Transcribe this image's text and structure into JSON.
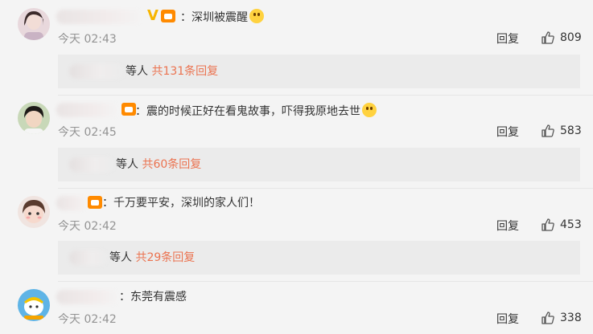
{
  "comments": [
    {
      "text": "：深圳被震醒",
      "has_v_badge": true,
      "time": "今天 02:43",
      "reply_label": "回复",
      "likes": "809",
      "sub": {
        "suffix": "等人",
        "count": "共131条回复"
      }
    },
    {
      "text": "：震的时候正好在看鬼故事，吓得我原地去世",
      "has_v_badge": false,
      "time": "今天 02:45",
      "reply_label": "回复",
      "likes": "583",
      "sub": {
        "suffix": "等人",
        "count": "共60条回复"
      }
    },
    {
      "text": "：千万要平安，深圳的家人们！",
      "has_v_badge": false,
      "time": "今天 02:42",
      "reply_label": "回复",
      "likes": "453",
      "sub": {
        "suffix": "等人",
        "count": "共29条回复"
      }
    },
    {
      "text": "：东莞有震感",
      "has_v_badge": false,
      "time": "今天 02:42",
      "reply_label": "回复",
      "likes": "338"
    }
  ],
  "icons": {
    "like": "thumbs-up-icon",
    "verified": "v-verified-badge-icon",
    "fan": "fan-badge-icon",
    "emoji": "emoji-icon"
  },
  "colors": {
    "background": "#f4f4f4",
    "reply_count": "#eb7350",
    "time": "#939393",
    "v_badge": "#f7b500",
    "fan_badge": "#ff8a00"
  }
}
